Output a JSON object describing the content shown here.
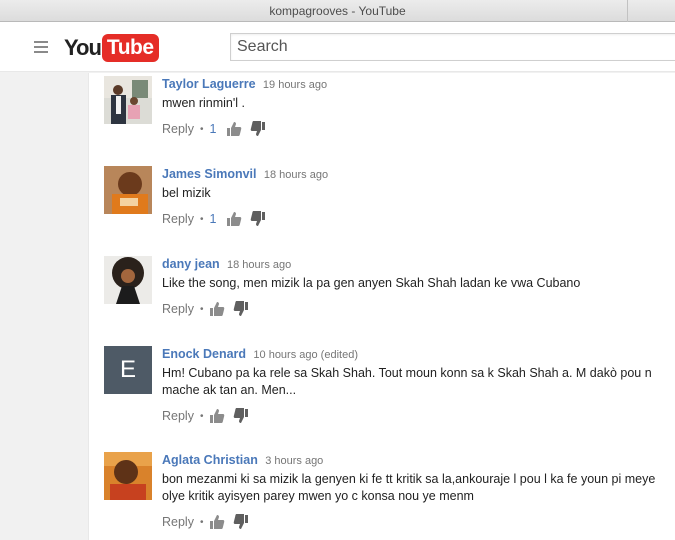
{
  "window": {
    "title": "kompagrooves - YouTube"
  },
  "masthead": {
    "logo_you": "You",
    "logo_tube": "Tube",
    "search_placeholder": "Search"
  },
  "comments": [
    {
      "author": "Taylor Laguerre",
      "time": "19 hours ago",
      "text": "mwen rinmin'l  .",
      "reply_label": "Reply",
      "likes": "1"
    },
    {
      "author": "James Simonvil",
      "time": "18 hours ago",
      "text": "bel mizik",
      "reply_label": "Reply",
      "likes": "1"
    },
    {
      "author": "dany jean",
      "time": "18 hours ago",
      "text": "Like the song, men mizik la pa gen anyen Skah Shah ladan ke vwa Cubano",
      "reply_label": "Reply",
      "likes": ""
    },
    {
      "author": "Enock Denard",
      "time": "10 hours ago (edited)",
      "avatar_letter": "E",
      "text": "Hm! Cubano pa ka rele sa Skah Shah. Tout moun konn sa k Skah Shah a. M dakò pou n mache ak tan an. Men...",
      "reply_label": "Reply",
      "likes": ""
    },
    {
      "author": "Aglata Christian",
      "time": "3 hours ago",
      "text": "bon mezanmi ki sa mizik la genyen ki fe tt kritik sa la,ankouraje l pou l ka fe youn pi meye olye kritik ayisyen parey mwen yo c konsa nou ye menm",
      "reply_label": "Reply",
      "likes": ""
    }
  ],
  "colors": {
    "author_link": "#4a78b9",
    "brand_red": "#e52d27",
    "meta_gray": "#767676"
  }
}
